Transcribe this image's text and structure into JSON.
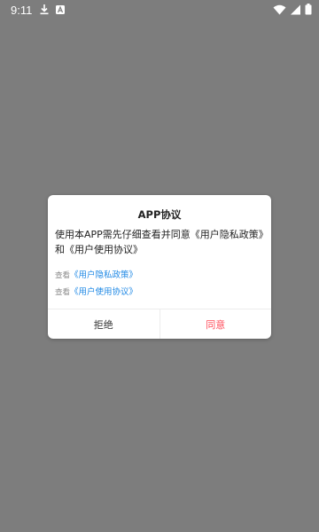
{
  "status_bar": {
    "time": "9:11",
    "left_icons": [
      "download-icon",
      "notification-a-icon"
    ],
    "right_icons": [
      "wifi-icon",
      "signal-icon",
      "battery-icon"
    ]
  },
  "dialog": {
    "title": "APP协议",
    "message": "使用本APP需先仔细查看并同意《用户隐私政策》和《用户使用协议》",
    "links": [
      {
        "prefix": "查看",
        "text": "《用户隐私政策》"
      },
      {
        "prefix": "查看",
        "text": "《用户使用协议》"
      }
    ],
    "reject_label": "拒绝",
    "agree_label": "同意"
  },
  "colors": {
    "overlay": "#7d7d7d",
    "link": "#1e88e5",
    "agree": "#ff4d5b"
  }
}
